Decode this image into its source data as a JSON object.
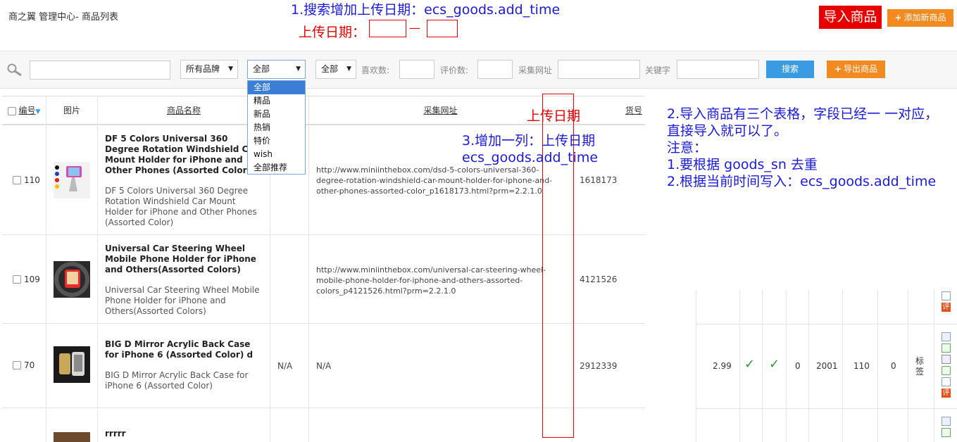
{
  "header": {
    "title": "商之翼 管理中心- 商品列表",
    "import_button": "导入商品",
    "add_button": "添加新商品"
  },
  "annotations": {
    "note1": "1.搜索增加上传日期：ecs_goods.add_time",
    "upload_date_label": "上传日期：",
    "dash": "—",
    "column_header_label": "上传日期",
    "note3_line1": "3.增加一列：上传日期",
    "note3_line2": "ecs_goods.add_time",
    "note2_line1": "2.导入商品有三个表格，字段已经一 一对应，",
    "note2_line2": "直接导入就可以了。",
    "note2_line3": "注意：",
    "note2_line4": "1.要根据 goods_sn 去重",
    "note2_line5": "2.根据当前时间写入：ecs_goods.add_time"
  },
  "search": {
    "brand_select": "所有品牌",
    "type_select": "全部",
    "status_select": "全部",
    "likes_label": "喜欢数:",
    "reviews_label": "评价数:",
    "url_label": "采集网址",
    "keyword_label": "关键字",
    "search_button": "搜索",
    "export_button": "导出商品"
  },
  "dropdown_options": [
    "全部",
    "精品",
    "新品",
    "热销",
    "特价",
    "wish",
    "全部推荐"
  ],
  "table": {
    "headers": {
      "id": "编号",
      "image": "图片",
      "name": "商品名称",
      "url": "采集网址",
      "sn": "货号"
    },
    "rows": [
      {
        "id": "110",
        "name": "DF 5 Colors Universal 360 Degree Rotation Windshield Car Mount Holder for iPhone and Other Phones (Assorted Color)",
        "desc": "DF 5 Colors Universal 360 Degree Rotation Windshield Car Mount Holder for iPhone and Other Phones (Assorted Color)",
        "brand": "",
        "url": "http://www.miniinthebox.com/dsd-5-colors-universal-360-degree-rotation-windshield-car-mount-holder-for-iphone-and-other-phones-assorted-color_p1618173.html?prm=2.2.1.0",
        "sn": "1618173"
      },
      {
        "id": "109",
        "name": "Universal Car Steering Wheel Mobile Phone Holder for iPhone and Others(Assorted Colors)",
        "desc": "Universal Car Steering Wheel Mobile Phone Holder for iPhone and Others(Assorted Colors)",
        "brand": "",
        "url": "http://www.miniinthebox.com/universal-car-steering-wheel-mobile-phone-holder-for-iphone-and-others-assorted-colors_p4121526.html?prm=2.2.1.0",
        "sn": "4121526"
      },
      {
        "id": "70",
        "name": "BIG D Mirror Acrylic Back Case for iPhone 6 (Assorted Color) d",
        "desc": "BIG D Mirror Acrylic Back Case for iPhone 6 (Assorted Color)",
        "brand": "N/A",
        "url": "N/A",
        "sn": "2912339",
        "price": "2.99",
        "stock": "0",
        "year": "2001",
        "qty": "110",
        "sort": "0",
        "tag": "标签"
      },
      {
        "id": "",
        "name": "rrrrr",
        "desc": "",
        "brand": "",
        "url": "",
        "sn": ""
      }
    ]
  },
  "icons": {
    "search": "magnifier-icon",
    "check": "✓",
    "review": "评"
  },
  "colors": {
    "accent_orange": "#f28a1f",
    "import_red": "#e60000",
    "search_blue": "#3a9be3",
    "annotation_blue": "#1a1adb",
    "annotation_red": "#e60000"
  }
}
